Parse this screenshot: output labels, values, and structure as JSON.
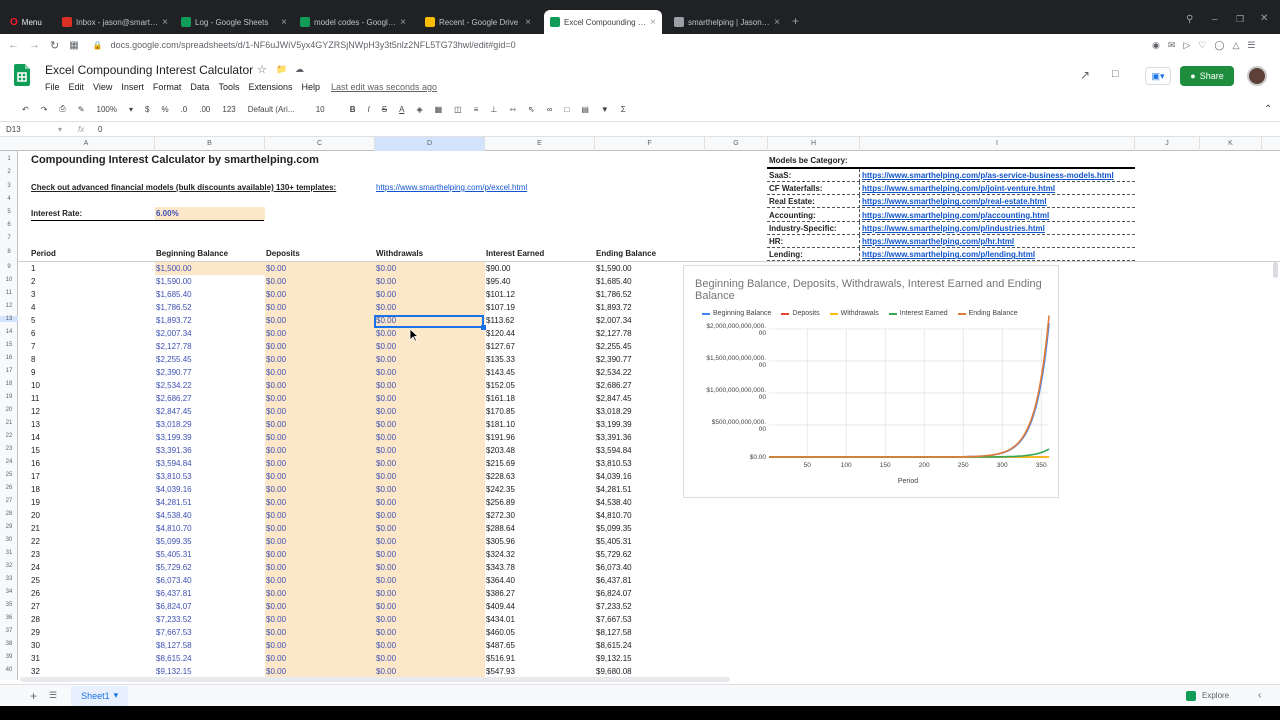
{
  "browser": {
    "menu_label": "Menu",
    "tabs": [
      {
        "label": "Inbox - jason@smarthelpi...",
        "color": "#d93025"
      },
      {
        "label": "Log - Google Sheets",
        "color": "#0f9d58"
      },
      {
        "label": "model codes - Google She...",
        "color": "#0f9d58"
      },
      {
        "label": "Recent - Google Drive",
        "color": "#fbbc04"
      },
      {
        "label": "Excel Compounding Intere...",
        "color": "#0f9d58"
      },
      {
        "label": "smarthelping | Jason Varne...",
        "color": "#9aa0a6"
      }
    ],
    "url": "docs.google.com/spreadsheets/d/1-NF6uJWiV5yx4GYZRSjNWpH3y3t5nlz2NFL5TG73hwl/edit#gid=0"
  },
  "doc": {
    "title": "Excel Compounding Interest Calculator",
    "menu": [
      "File",
      "Edit",
      "View",
      "Insert",
      "Format",
      "Data",
      "Tools",
      "Extensions",
      "Help"
    ],
    "last_edit": "Last edit was seconds ago",
    "share_label": "Share"
  },
  "toolbar": {
    "zoom": "100%",
    "currency": "$",
    "percent": "%",
    "dec_decrease": ".0",
    "dec_increase": ".00",
    "format": "123",
    "font": "Default (Ari...",
    "font_size": "10",
    "bold": "B",
    "italic": "I",
    "strike": "S",
    "text_color": "A",
    "sum": "Σ"
  },
  "formula": {
    "cell_ref": "D13",
    "fx": "fx",
    "value": "0"
  },
  "columns": [
    "A",
    "B",
    "C",
    "D",
    "E",
    "F",
    "G",
    "H",
    "I",
    "J",
    "K"
  ],
  "sheet": {
    "title": "Compounding Interest Calculator by smarthelping.com",
    "promo_text": "Check out advanced financial models (bulk discounts available) 130+ templates:",
    "promo_link": "https://www.smarthelping.com/p/excel.html",
    "rate_label": "Interest Rate:",
    "rate_value": "6.00%",
    "headers": [
      "Period",
      "Beginning Balance",
      "Deposits",
      "Withdrawals",
      "Interest Earned",
      "Ending Balance"
    ],
    "models_title": "Models be Category:",
    "models": [
      {
        "cat": "SaaS:",
        "url": "https://www.smarthelping.com/p/as-service-business-models.html"
      },
      {
        "cat": "CF Waterfalls:",
        "url": "https://www.smarthelping.com/p/joint-venture.html"
      },
      {
        "cat": "Real Estate:",
        "url": "https://www.smarthelping.com/p/real-estate.html"
      },
      {
        "cat": "Accounting:",
        "url": "https://www.smarthelping.com/p/accounting.html"
      },
      {
        "cat": "Industry-Specific:",
        "url": "https://www.smarthelping.com/p/industries.html"
      },
      {
        "cat": "HR:",
        "url": "https://www.smarthelping.com/p/hr.html"
      },
      {
        "cat": "Lending:",
        "url": "https://www.smarthelping.com/p/lending.html"
      }
    ],
    "rows": [
      [
        "1",
        "$1,500.00",
        "$0.00",
        "$0.00",
        "$90.00",
        "$1,590.00"
      ],
      [
        "2",
        "$1,590.00",
        "$0.00",
        "$0.00",
        "$95.40",
        "$1,685.40"
      ],
      [
        "3",
        "$1,685.40",
        "$0.00",
        "$0.00",
        "$101.12",
        "$1,786.52"
      ],
      [
        "4",
        "$1,786.52",
        "$0.00",
        "$0.00",
        "$107.19",
        "$1,893.72"
      ],
      [
        "5",
        "$1,893.72",
        "$0.00",
        "$0.00",
        "$113.62",
        "$2,007.34"
      ],
      [
        "6",
        "$2,007.34",
        "$0.00",
        "$0.00",
        "$120.44",
        "$2,127.78"
      ],
      [
        "7",
        "$2,127.78",
        "$0.00",
        "$0.00",
        "$127.67",
        "$2,255.45"
      ],
      [
        "8",
        "$2,255.45",
        "$0.00",
        "$0.00",
        "$135.33",
        "$2,390.77"
      ],
      [
        "9",
        "$2,390.77",
        "$0.00",
        "$0.00",
        "$143.45",
        "$2,534.22"
      ],
      [
        "10",
        "$2,534.22",
        "$0.00",
        "$0.00",
        "$152.05",
        "$2,686.27"
      ],
      [
        "11",
        "$2,686.27",
        "$0.00",
        "$0.00",
        "$161.18",
        "$2,847.45"
      ],
      [
        "12",
        "$2,847.45",
        "$0.00",
        "$0.00",
        "$170.85",
        "$3,018.29"
      ],
      [
        "13",
        "$3,018.29",
        "$0.00",
        "$0.00",
        "$181.10",
        "$3,199.39"
      ],
      [
        "14",
        "$3,199.39",
        "$0.00",
        "$0.00",
        "$191.96",
        "$3,391.36"
      ],
      [
        "15",
        "$3,391.36",
        "$0.00",
        "$0.00",
        "$203.48",
        "$3,594.84"
      ],
      [
        "16",
        "$3,594.84",
        "$0.00",
        "$0.00",
        "$215.69",
        "$3,810.53"
      ],
      [
        "17",
        "$3,810.53",
        "$0.00",
        "$0.00",
        "$228.63",
        "$4,039.16"
      ],
      [
        "18",
        "$4,039.16",
        "$0.00",
        "$0.00",
        "$242.35",
        "$4,281.51"
      ],
      [
        "19",
        "$4,281.51",
        "$0.00",
        "$0.00",
        "$256.89",
        "$4,538.40"
      ],
      [
        "20",
        "$4,538.40",
        "$0.00",
        "$0.00",
        "$272.30",
        "$4,810.70"
      ],
      [
        "21",
        "$4,810.70",
        "$0.00",
        "$0.00",
        "$288.64",
        "$5,099.35"
      ],
      [
        "22",
        "$5,099.35",
        "$0.00",
        "$0.00",
        "$305.96",
        "$5,405.31"
      ],
      [
        "23",
        "$5,405.31",
        "$0.00",
        "$0.00",
        "$324.32",
        "$5,729.62"
      ],
      [
        "24",
        "$5,729.62",
        "$0.00",
        "$0.00",
        "$343.78",
        "$6,073.40"
      ],
      [
        "25",
        "$6,073.40",
        "$0.00",
        "$0.00",
        "$364.40",
        "$6,437.81"
      ],
      [
        "26",
        "$6,437.81",
        "$0.00",
        "$0.00",
        "$386.27",
        "$6,824.07"
      ],
      [
        "27",
        "$6,824.07",
        "$0.00",
        "$0.00",
        "$409.44",
        "$7,233.52"
      ],
      [
        "28",
        "$7,233.52",
        "$0.00",
        "$0.00",
        "$434.01",
        "$7,667.53"
      ],
      [
        "29",
        "$7,667.53",
        "$0.00",
        "$0.00",
        "$460.05",
        "$8,127.58"
      ],
      [
        "30",
        "$8,127.58",
        "$0.00",
        "$0.00",
        "$487.65",
        "$8,615.24"
      ],
      [
        "31",
        "$8,615.24",
        "$0.00",
        "$0.00",
        "$516.91",
        "$9,132.15"
      ],
      [
        "32",
        "$9,132.15",
        "$0.00",
        "$0.00",
        "$547.93",
        "$9,680.08"
      ]
    ],
    "row_numbers": [
      "1",
      "2",
      "3",
      "4",
      "5",
      "6",
      "7",
      "8",
      "9",
      "10",
      "11",
      "12",
      "13",
      "14",
      "15",
      "16",
      "17",
      "18",
      "19",
      "20",
      "21",
      "22",
      "23",
      "24",
      "25",
      "26",
      "27",
      "28",
      "29",
      "30",
      "31",
      "32",
      "33",
      "34",
      "35",
      "36",
      "37",
      "38",
      "39",
      "40"
    ]
  },
  "sheet_tab": {
    "label": "Sheet1",
    "explore": "Explore"
  },
  "chart_data": {
    "type": "line",
    "title": "Beginning Balance, Deposits, Withdrawals, Interest Earned and Ending Balance",
    "xlabel": "Period",
    "ylabel": "",
    "xlim": [
      1,
      360
    ],
    "ylim": [
      0,
      2000000000000
    ],
    "x_ticks": [
      "50",
      "100",
      "150",
      "200",
      "250",
      "300",
      "350"
    ],
    "y_ticks": [
      "$0.00",
      "$500,000,000,000.00",
      "$1,000,000,000,000.00",
      "$1,500,000,000,000.00",
      "$2,000,000,000,000.00"
    ],
    "legend_position": "top",
    "series": [
      {
        "name": "Beginning Balance",
        "color": "#4285f4",
        "x": [
          1,
          100,
          200,
          250,
          300,
          320,
          340,
          350,
          360
        ],
        "values": [
          1500,
          540000,
          183000000,
          3390000000,
          62800000000,
          202000000000,
          650000000000,
          1170000000000,
          2090000000000
        ]
      },
      {
        "name": "Deposits",
        "color": "#ea4335",
        "x": [
          1,
          360
        ],
        "values": [
          0,
          0
        ]
      },
      {
        "name": "Withdrawals",
        "color": "#fbbc04",
        "x": [
          1,
          360
        ],
        "values": [
          0,
          0
        ]
      },
      {
        "name": "Interest Earned",
        "color": "#34a853",
        "x": [
          1,
          100,
          200,
          250,
          300,
          320,
          340,
          350,
          360
        ],
        "values": [
          90,
          32400,
          11000000,
          203000000,
          3770000000,
          12100000000,
          39000000000,
          70000000000,
          125000000000
        ]
      },
      {
        "name": "Ending Balance",
        "color": "#e07b39",
        "x": [
          1,
          100,
          200,
          250,
          300,
          320,
          340,
          350,
          360
        ],
        "values": [
          1590,
          572000,
          194000000,
          3590000000,
          66600000000,
          214000000000,
          689000000000,
          1240000000000,
          2210000000000
        ]
      }
    ]
  }
}
